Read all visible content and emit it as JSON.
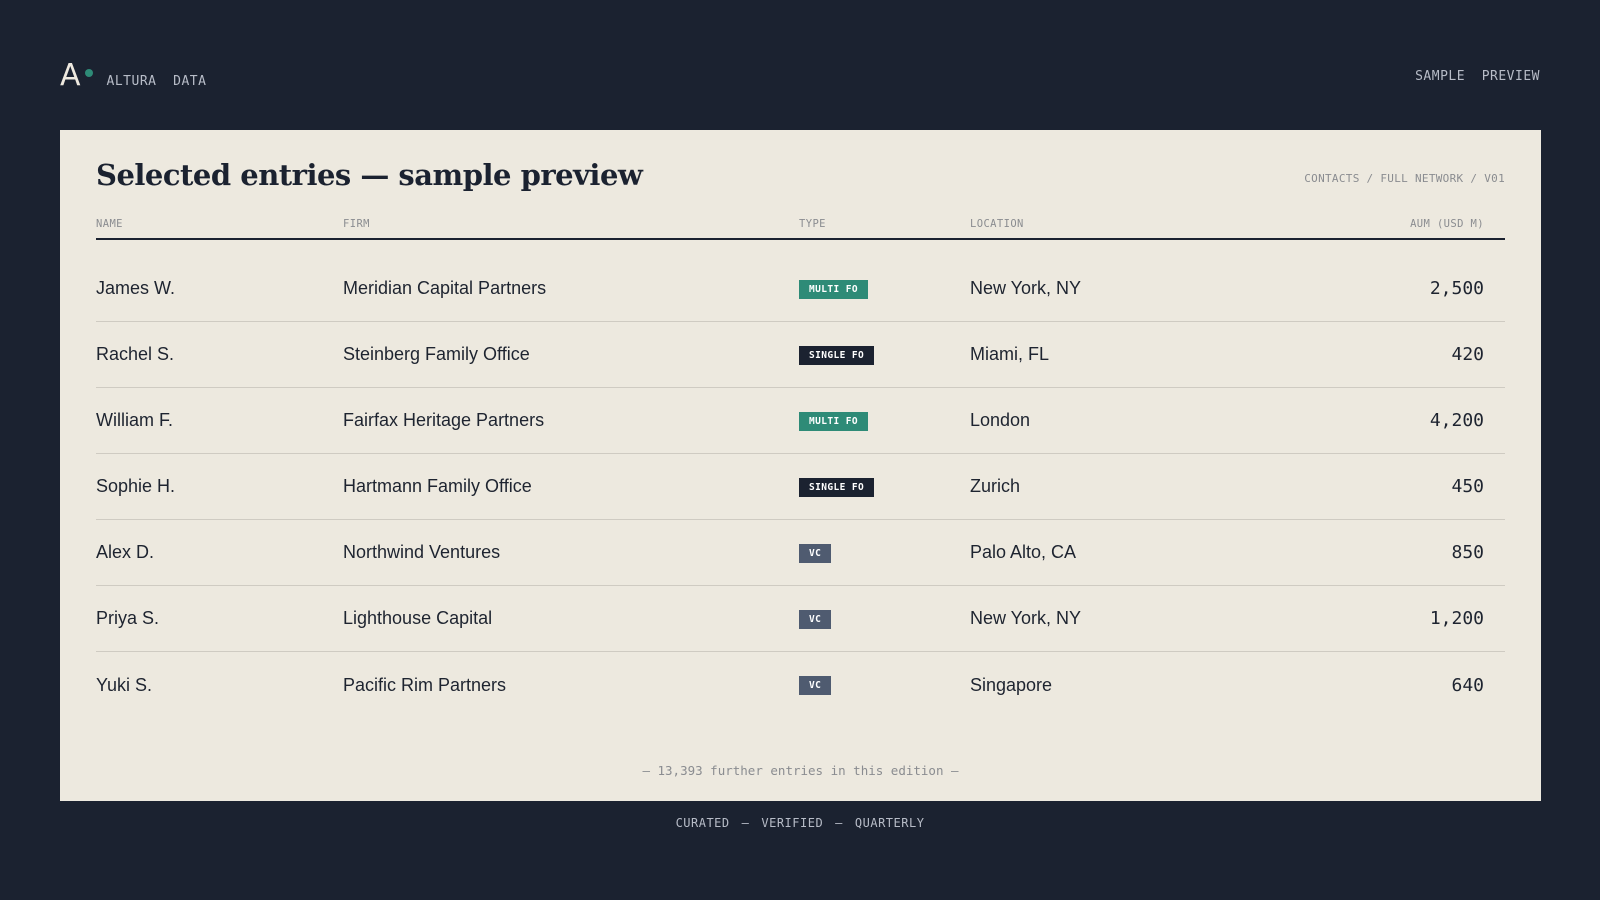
{
  "header": {
    "logo_letter": "A",
    "brand_name": "ALTURA  DATA",
    "right_label": "SAMPLE  PREVIEW"
  },
  "card": {
    "title": "Selected entries — sample preview",
    "meta": "CONTACTS / FULL NETWORK / V01"
  },
  "table": {
    "columns": [
      "NAME",
      "FIRM",
      "TYPE",
      "LOCATION",
      "AUM (USD M)"
    ],
    "rows": [
      {
        "name": "James W.",
        "firm": "Meridian Capital Partners",
        "type": "MULTI FO",
        "location": "New York, NY",
        "aum": "2,500"
      },
      {
        "name": "Rachel S.",
        "firm": "Steinberg Family Office",
        "type": "SINGLE FO",
        "location": "Miami, FL",
        "aum": "420"
      },
      {
        "name": "William F.",
        "firm": "Fairfax Heritage Partners",
        "type": "MULTI FO",
        "location": "London",
        "aum": "4,200"
      },
      {
        "name": "Sophie H.",
        "firm": "Hartmann Family Office",
        "type": "SINGLE FO",
        "location": "Zurich",
        "aum": "450"
      },
      {
        "name": "Alex D.",
        "firm": "Northwind Ventures",
        "type": "VC",
        "location": "Palo Alto, CA",
        "aum": "850"
      },
      {
        "name": "Priya S.",
        "firm": "Lighthouse Capital",
        "type": "VC",
        "location": "New York, NY",
        "aum": "1,200"
      },
      {
        "name": "Yuki S.",
        "firm": "Pacific Rim Partners",
        "type": "VC",
        "location": "Singapore",
        "aum": "640"
      }
    ]
  },
  "badge_colors": {
    "MULTI FO": "#2e8b77",
    "SINGLE FO": "#1b2230",
    "VC": "#4f5b70"
  },
  "footnote": "— 13,393 further entries in this edition —",
  "tagline": [
    "CURATED",
    "—",
    "VERIFIED",
    "—",
    "QUARTERLY"
  ],
  "colors": {
    "background": "#1b2230",
    "card": "#ede9df",
    "accent": "#2e8b77"
  }
}
